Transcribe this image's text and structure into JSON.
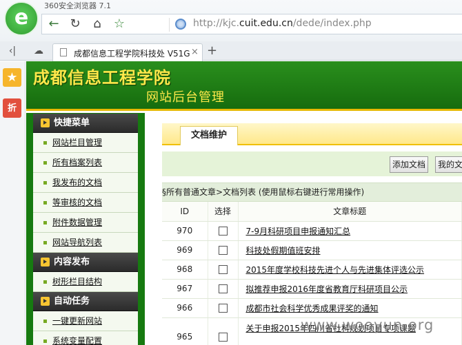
{
  "browser": {
    "app_title": "360安全浏览器 7.1",
    "url_prefix": "http://kjc.",
    "url_domain": "cuit.edu.cn",
    "url_path": "/dede/index.php",
    "tab_title": "成都信息工程学院科技处 V51GB",
    "tab_close": "×",
    "new_tab": "+",
    "favorites_icon": "star-icon",
    "discount_label": "折"
  },
  "site": {
    "title": "成都信息工程学院",
    "subtitle": "网站后台管理"
  },
  "menu": {
    "groups": [
      {
        "header": "快捷菜单",
        "items": [
          "网站栏目管理",
          "所有档案列表",
          "我发布的文档",
          "等审核的文档",
          "附件数据管理",
          "网站导航列表"
        ]
      },
      {
        "header": "内容发布",
        "items": [
          "树形栏目结构"
        ]
      },
      {
        "header": "自动任务",
        "items": [
          "一键更新网站",
          "系统变量配置"
        ]
      }
    ]
  },
  "main": {
    "tab": "文档维护",
    "buttons": [
      "添加文档",
      "我的文"
    ],
    "breadcrumb": "§所有普通文章>文档列表 (使用鼠标右键进行常用操作)",
    "columns": [
      "ID",
      "选择",
      "文章标题"
    ],
    "rows": [
      {
        "id": "970",
        "title": "7-9月科研项目申报通知汇总"
      },
      {
        "id": "969",
        "title": "科技处假期值班安排"
      },
      {
        "id": "968",
        "title": "2015年度学校科技先进个人与先进集体评选公示"
      },
      {
        "id": "967",
        "title": "拟推荐申报2016年度省教育厅科研项目公示"
      },
      {
        "id": "966",
        "title": "成都市社会科学优秀成果评奖的通知"
      },
      {
        "id": "965",
        "title": "关于申报2015年四川省社科规划项目专项课题"
      }
    ]
  },
  "watermark": "www.wooyun.org"
}
